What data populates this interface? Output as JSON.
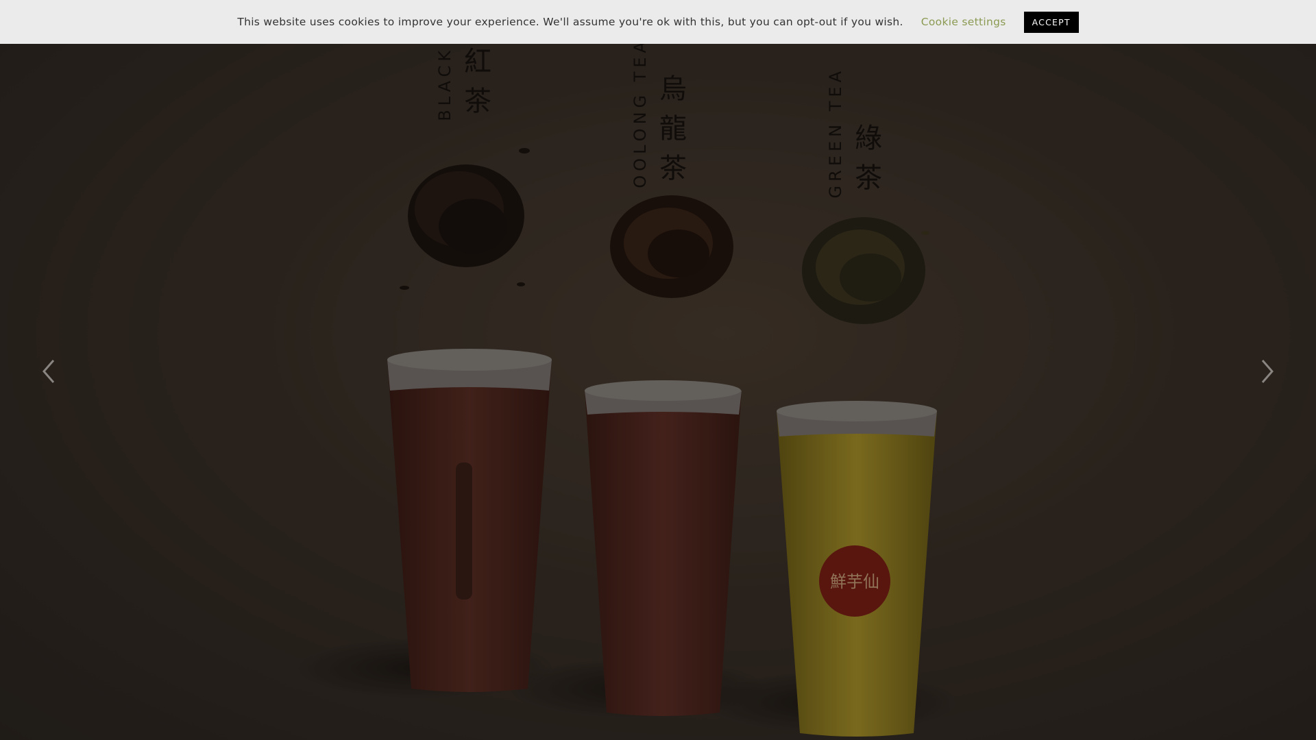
{
  "cookie_bar": {
    "message": "This website uses cookies to improve your experience. We'll assume you're ok with this, but you can opt-out if you wish.",
    "settings_label": "Cookie settings",
    "accept_label": "ACCEPT"
  },
  "slider": {
    "prev_icon": "chevron-left-icon",
    "next_icon": "chevron-right-icon"
  },
  "teas": [
    {
      "en": "BLACK TEA",
      "zh": [
        "紅",
        "茶"
      ],
      "liquid": "#5a2e24"
    },
    {
      "en": "OOLONG TEA",
      "zh": [
        "烏",
        "龍",
        "茶"
      ],
      "liquid": "#5e2e26"
    },
    {
      "en": "GREEN TEA",
      "zh": [
        "綠",
        "茶"
      ],
      "liquid": "#a8922a"
    }
  ],
  "cup_logos": {
    "green_tea_logo": "鮮芋仙"
  },
  "colors": {
    "background": "#3a3028",
    "cookie_bar": "#ebebeb",
    "accept_button": "#000000",
    "cookie_settings_link": "#8a9a52"
  }
}
